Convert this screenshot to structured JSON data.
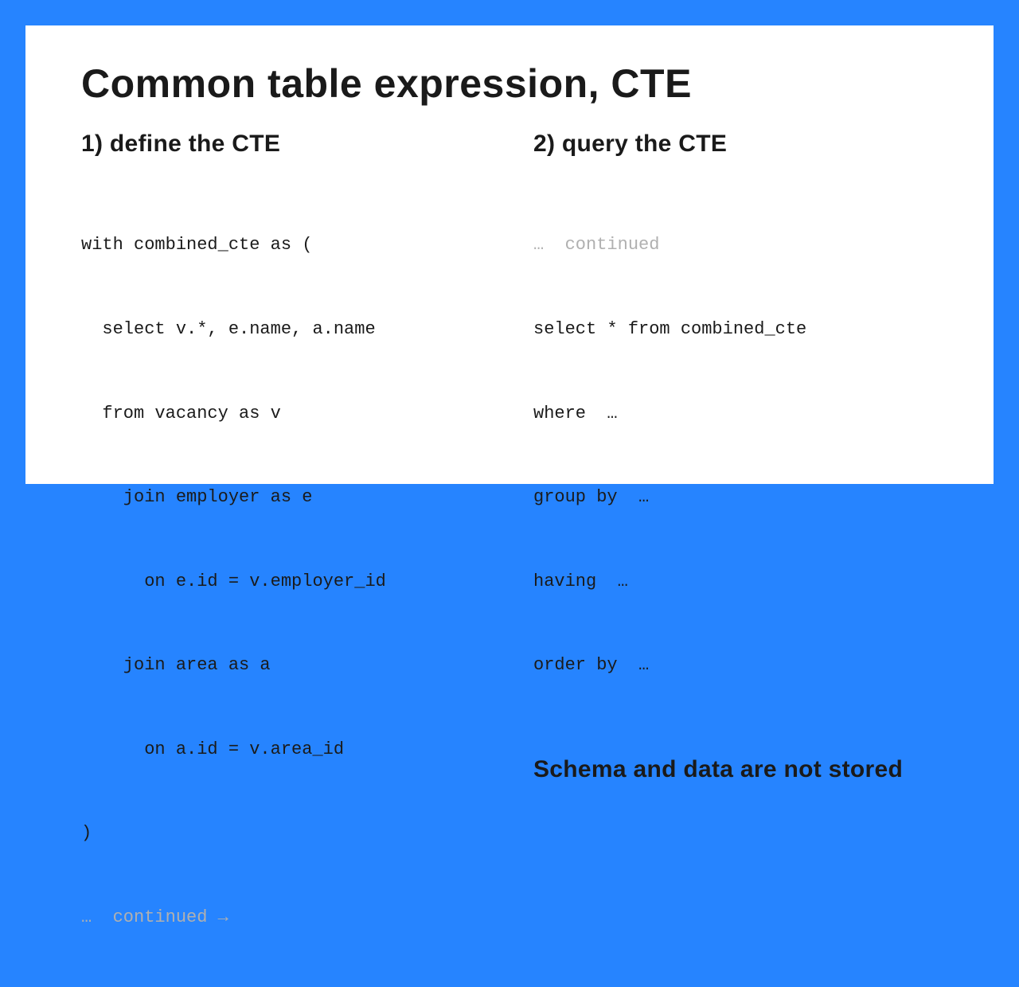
{
  "title": "Common table expression, CTE",
  "left": {
    "heading": "1) define the CTE",
    "code_lines": [
      "with combined_cte as (",
      "  select v.*, e.name, a.name",
      "  from vacancy as v",
      "    join employer as e",
      "      on e.id = v.employer_id",
      "    join area as a",
      "      on a.id = v.area_id",
      ")"
    ],
    "continued_prefix": "…  ",
    "continued_text": "continued →"
  },
  "right": {
    "heading": "2) query the CTE",
    "continued_prefix": "…  ",
    "continued_text": "continued",
    "code_lines": [
      "select * from combined_cte",
      "where  …",
      "group by  …",
      "having  …",
      "order by  …"
    ],
    "note": "Schema and data are not stored"
  }
}
